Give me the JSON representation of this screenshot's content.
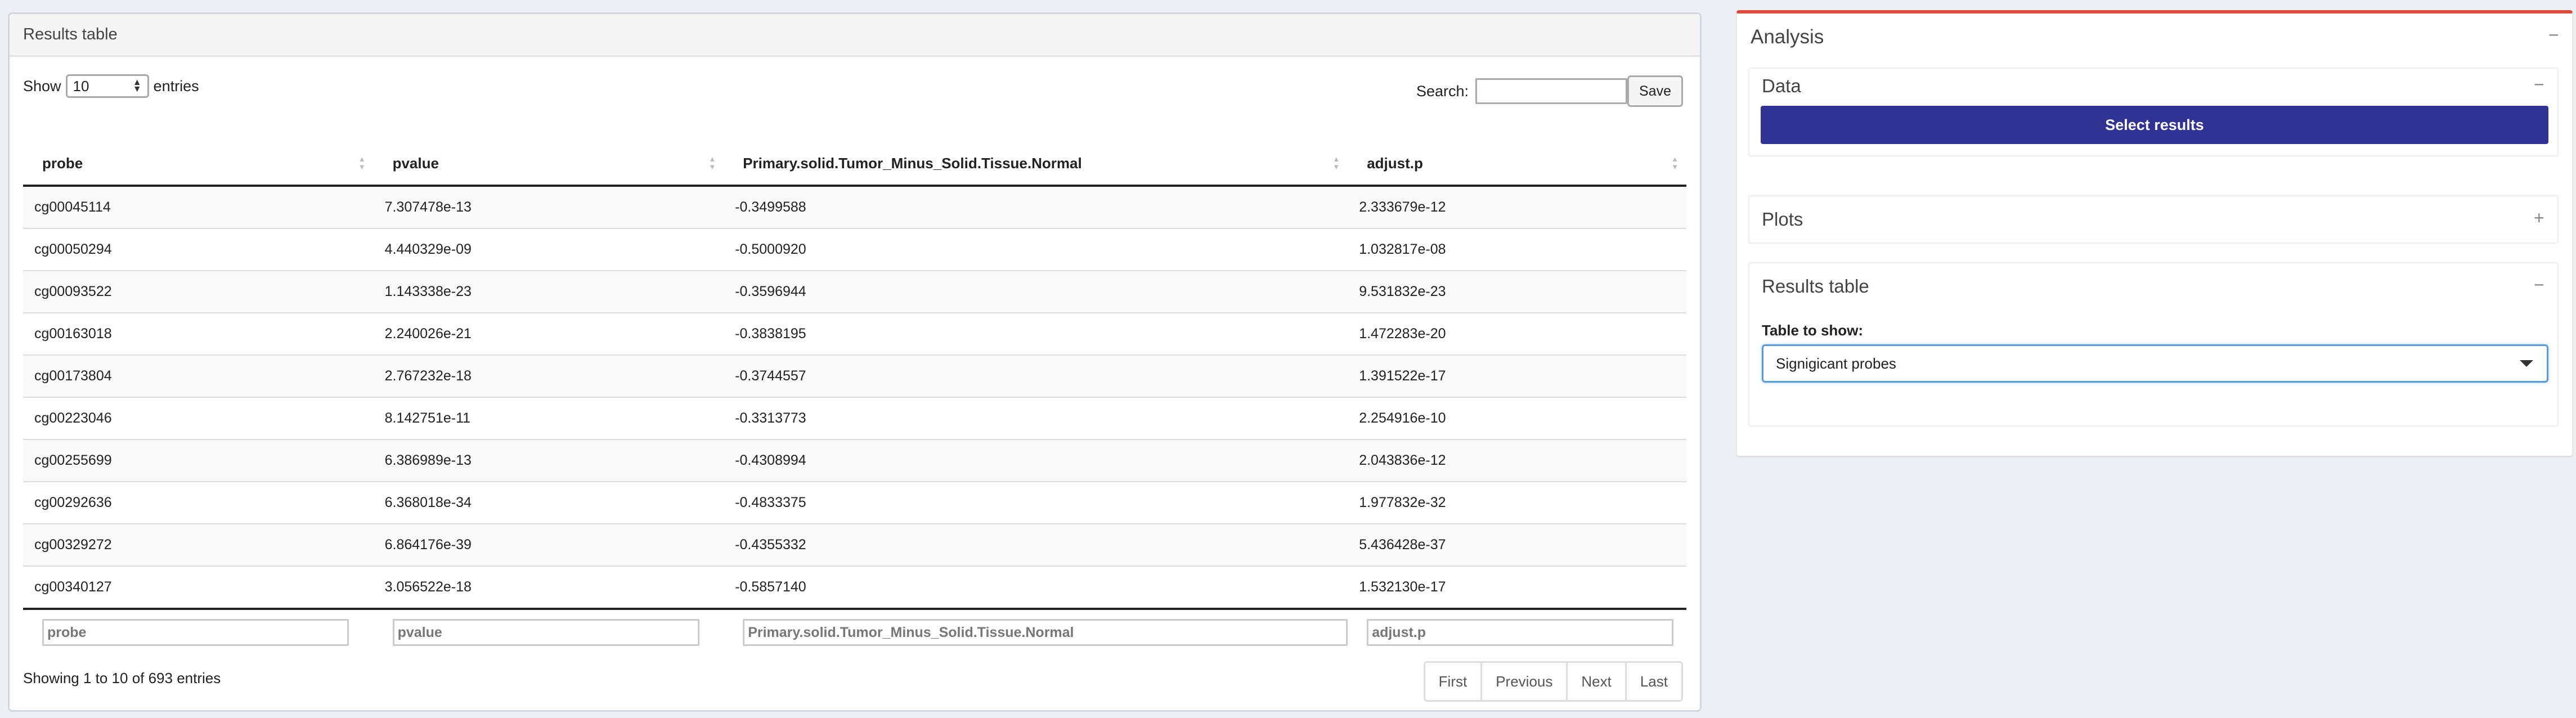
{
  "results_box": {
    "title": "Results table",
    "show_label": "Show",
    "page_length": "10",
    "entries_label": "entries",
    "search_label": "Search:",
    "search_value": "",
    "save_label": "Save",
    "columns": [
      "probe",
      "pvalue",
      "Primary.solid.Tumor_Minus_Solid.Tissue.Normal",
      "adjust.p"
    ],
    "rows": [
      [
        "cg00045114",
        "7.307478e-13",
        "-0.3499588",
        "2.333679e-12"
      ],
      [
        "cg00050294",
        "4.440329e-09",
        "-0.5000920",
        "1.032817e-08"
      ],
      [
        "cg00093522",
        "1.143338e-23",
        "-0.3596944",
        "9.531832e-23"
      ],
      [
        "cg00163018",
        "2.240026e-21",
        "-0.3838195",
        "1.472283e-20"
      ],
      [
        "cg00173804",
        "2.767232e-18",
        "-0.3744557",
        "1.391522e-17"
      ],
      [
        "cg00223046",
        "8.142751e-11",
        "-0.3313773",
        "2.254916e-10"
      ],
      [
        "cg00255699",
        "6.386989e-13",
        "-0.4308994",
        "2.043836e-12"
      ],
      [
        "cg00292636",
        "6.368018e-34",
        "-0.4833375",
        "1.977832e-32"
      ],
      [
        "cg00329272",
        "6.864176e-39",
        "-0.4355332",
        "5.436428e-37"
      ],
      [
        "cg00340127",
        "3.056522e-18",
        "-0.5857140",
        "1.532130e-17"
      ]
    ],
    "footer_filters": [
      "probe",
      "pvalue",
      "Primary.solid.Tumor_Minus_Solid.Tissue.Normal",
      "adjust.p"
    ],
    "info": "Showing 1 to 10 of 693 entries",
    "pager": [
      "First",
      "Previous",
      "Next",
      "Last"
    ]
  },
  "analysis": {
    "title": "Analysis",
    "collapse_symbol": "−",
    "data_section": {
      "title": "Data",
      "symbol": "−",
      "button": "Select results"
    },
    "plots_section": {
      "title": "Plots",
      "symbol": "+"
    },
    "results_section": {
      "title": "Results table",
      "symbol": "−",
      "field_label": "Table to show:",
      "selected": "Signigicant probes"
    }
  },
  "colors": {
    "accent_red": "#dd4b39",
    "button_blue": "#303394",
    "focus_blue": "#5b9bd5"
  }
}
